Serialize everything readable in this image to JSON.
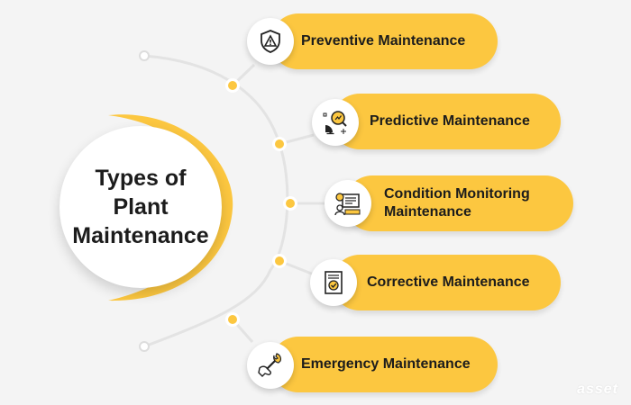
{
  "diagram": {
    "title_lines": [
      "Types of",
      "Plant",
      "Maintenance"
    ],
    "colors": {
      "accent": "#fcc740",
      "accent_dark": "#f5b800",
      "background": "#f4f4f4",
      "line": "#e3e3e3",
      "text": "#1c1c1c"
    },
    "items": [
      {
        "label": "Preventive Maintenance",
        "icon": "shield-warning-icon"
      },
      {
        "label": "Predictive Maintenance",
        "icon": "analytics-magnifier-icon"
      },
      {
        "label": "Condition Monitoring Maintenance",
        "icon": "monitoring-dashboard-icon"
      },
      {
        "label": "Corrective Maintenance",
        "icon": "checklist-document-icon"
      },
      {
        "label": "Emergency Maintenance",
        "icon": "wrench-hand-icon"
      }
    ],
    "watermark": "asset"
  }
}
